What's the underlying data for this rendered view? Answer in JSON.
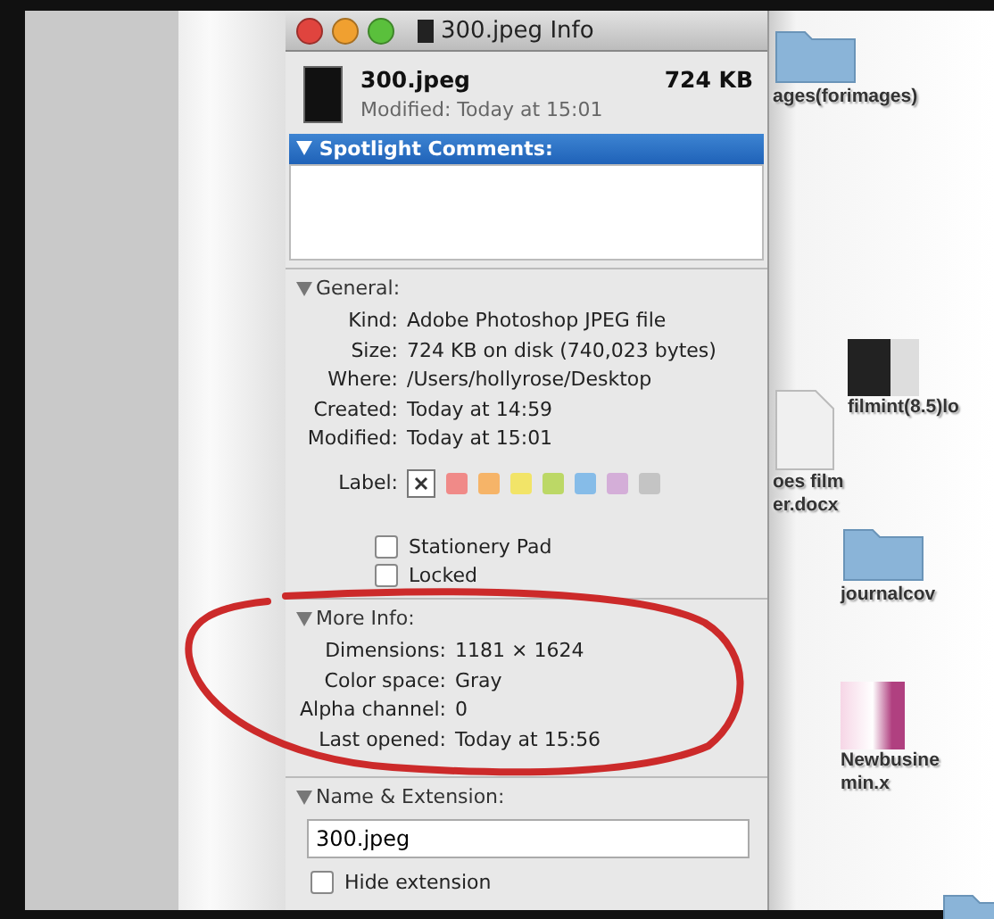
{
  "window": {
    "title": "300.jpeg Info"
  },
  "header": {
    "name": "300.jpeg",
    "size": "724 KB",
    "modified": "Modified: Today at 15:01"
  },
  "spotlight": {
    "title": "Spotlight Comments:",
    "expanded": true
  },
  "general": {
    "title": "General:",
    "expanded": true,
    "rows": [
      {
        "label": "Kind:",
        "value": "Adobe Photoshop JPEG file"
      },
      {
        "label": "Size:",
        "value": "724 KB on disk (740,023 bytes)"
      },
      {
        "label": "Where:",
        "value": "/Users/hollyrose/Desktop"
      },
      {
        "label": "Created:",
        "value": "Today at 14:59"
      },
      {
        "label": "Modified:",
        "value": "Today at 15:01"
      }
    ],
    "label_title": "Label:",
    "label_choices": [
      {
        "kind": "none",
        "selected": true
      },
      {
        "kind": "swatch",
        "color": "#f08a88",
        "selected": false
      },
      {
        "kind": "swatch",
        "color": "#f6b468",
        "selected": false
      },
      {
        "kind": "swatch",
        "color": "#f2e468",
        "selected": false
      },
      {
        "kind": "swatch",
        "color": "#bcd866",
        "selected": false
      },
      {
        "kind": "swatch",
        "color": "#86bce8",
        "selected": false
      },
      {
        "kind": "swatch",
        "color": "#d4aed8",
        "selected": false
      },
      {
        "kind": "swatch",
        "color": "#c4c4c4",
        "selected": false
      }
    ],
    "checkboxes": [
      {
        "label": "Stationery Pad",
        "checked": false
      },
      {
        "label": "Locked",
        "checked": false
      }
    ]
  },
  "more_info": {
    "title": "More Info:",
    "expanded": true,
    "rows": [
      {
        "label": "Dimensions:",
        "value": "1181 × 1624"
      },
      {
        "label": "Color space:",
        "value": "Gray"
      },
      {
        "label": "Alpha channel:",
        "value": "0"
      },
      {
        "label": "Last opened:",
        "value": "Today at 15:56"
      }
    ]
  },
  "name_extension": {
    "title": "Name & Extension:",
    "expanded": true,
    "value": "300.jpeg",
    "hide_extension": {
      "label": "Hide extension",
      "checked": false
    }
  },
  "desktop": [
    {
      "kind": "folder",
      "lines": [
        "ages(forimages)"
      ]
    },
    {
      "kind": "image",
      "lines": [
        "filmint(8.5)lo"
      ]
    },
    {
      "kind": "document",
      "lines": [
        "oes film",
        "er.docx"
      ]
    },
    {
      "kind": "folder",
      "lines": [
        "journalcov"
      ]
    },
    {
      "kind": "sheet",
      "lines": [
        "Newbusine",
        "min.x"
      ]
    },
    {
      "kind": "folder"
    }
  ]
}
